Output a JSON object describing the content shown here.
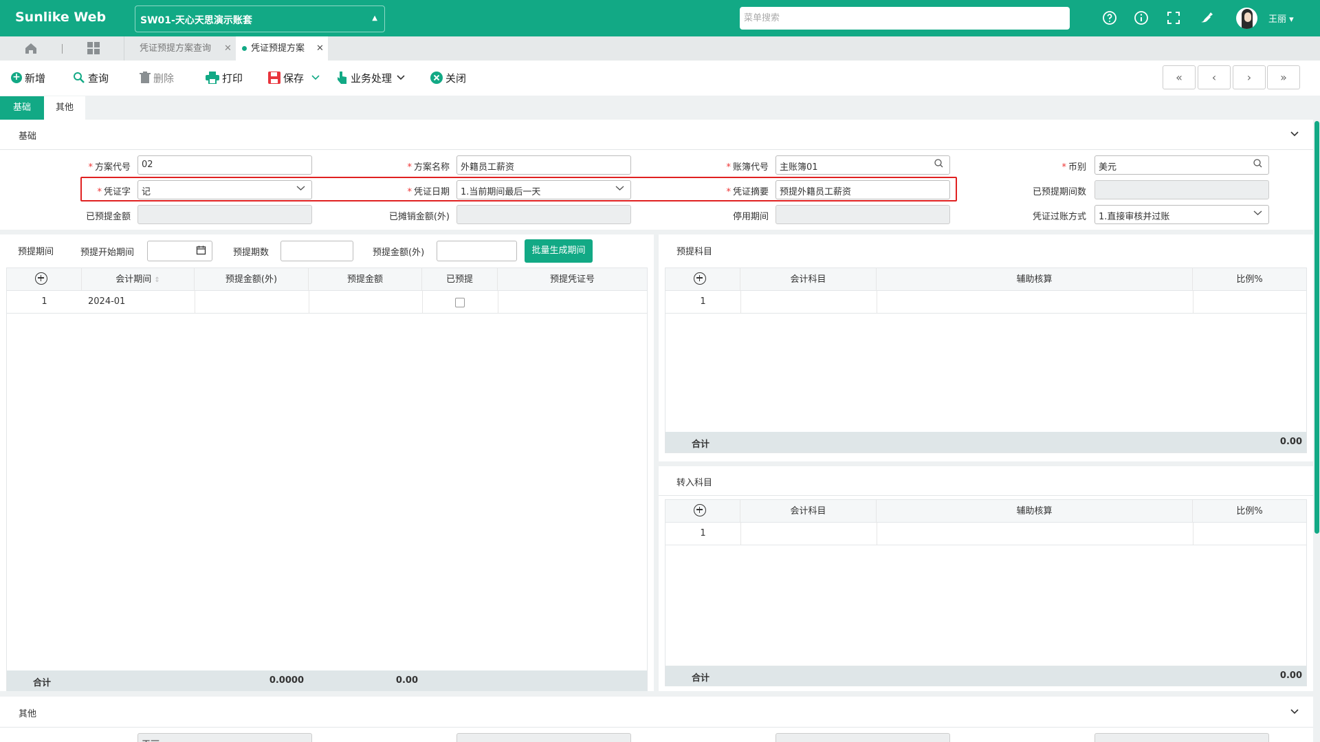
{
  "app": {
    "brand": "Sunlike Web",
    "account": "SW01-天心天思演示账套",
    "search_placeholder": "菜单搜索",
    "user": "王丽",
    "user_caret": "▾"
  },
  "tabs": [
    {
      "label": "凭证预提方案查询"
    },
    {
      "label": "凭证预提方案",
      "active": true
    }
  ],
  "toolbar": {
    "new": "新增",
    "query": "查询",
    "delete": "删除",
    "print": "打印",
    "save": "保存",
    "business": "业务处理",
    "close": "关闭",
    "nav": [
      "«",
      "‹",
      "›",
      "»"
    ]
  },
  "subtabs": [
    "基础",
    "其他"
  ],
  "basic": {
    "section_title": "基础",
    "scheme_code": {
      "label": "方案代号",
      "value": "02"
    },
    "scheme_name": {
      "label": "方案名称",
      "value": "外籍员工薪资"
    },
    "ledger_code": {
      "label": "账簿代号",
      "value": "主账簿01"
    },
    "currency": {
      "label": "币别",
      "value": "美元"
    },
    "voucher_word": {
      "label": "凭证字",
      "value": "记"
    },
    "voucher_date": {
      "label": "凭证日期",
      "value": "1.当前期间最后一天"
    },
    "voucher_summary": {
      "label": "凭证摘要",
      "value": "预提外籍员工薪资"
    },
    "accrued_periods": {
      "label": "已预提期间数",
      "value": ""
    },
    "accrued_amount": {
      "label": "已预提金额",
      "value": ""
    },
    "amortized_amount": {
      "label": "已摊销金额(外)",
      "value": ""
    },
    "disabled_period": {
      "label": "停用期间",
      "value": ""
    },
    "posting_method": {
      "label": "凭证过账方式",
      "value": "1.直接审核并过账"
    }
  },
  "period_panel": {
    "title": "预提期间",
    "start_label": "预提开始期间",
    "count_label": "预提期数",
    "amount_label": "预提金额(外)",
    "batch_button": "批量生成期间",
    "columns": [
      "会计期间",
      "预提金额(外)",
      "预提金额",
      "已预提",
      "预提凭证号"
    ],
    "rows": [
      {
        "no": "1",
        "period": "2024-01",
        "amt_foreign": "",
        "amt": "",
        "accrued": false,
        "voucher_no": ""
      }
    ],
    "footer": {
      "label": "合计",
      "amt_foreign": "0.0000",
      "amt": "0.00"
    }
  },
  "accrual_subject": {
    "title": "预提科目",
    "columns": [
      "会计科目",
      "辅助核算",
      "比例%"
    ],
    "rows": [
      {
        "no": "1"
      }
    ],
    "footer": {
      "label": "合计",
      "value": "0.00"
    }
  },
  "transfer_subject": {
    "title": "转入科目",
    "columns": [
      "会计科目",
      "辅助核算",
      "比例%"
    ],
    "rows": [
      {
        "no": "1"
      }
    ],
    "footer": {
      "label": "合计",
      "value": "0.00"
    }
  },
  "other": {
    "section_title": "其他",
    "first_field_value": "王丽"
  },
  "colors": {
    "brand": "#12a985",
    "highlight": "#e02020",
    "required": "#e33333"
  }
}
